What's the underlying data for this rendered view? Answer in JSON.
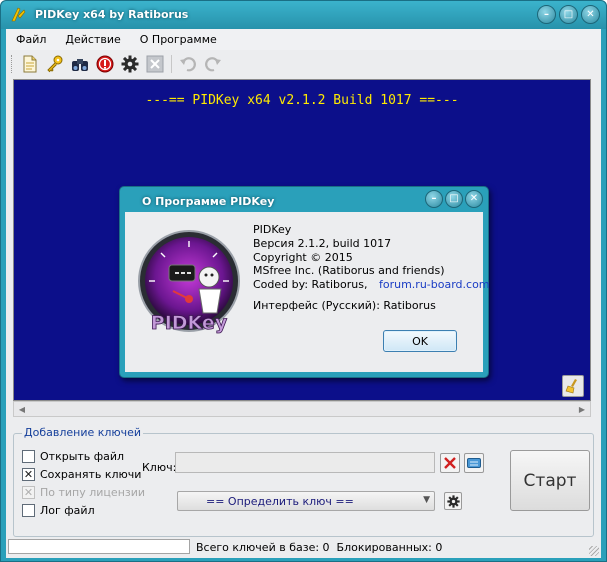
{
  "window": {
    "title": "PIDKey x64 by Ratiborus",
    "buttons": {
      "minimize": "–",
      "maximize": "□",
      "close": "✕"
    }
  },
  "menu": {
    "items": [
      "Файл",
      "Действие",
      "О Программе"
    ]
  },
  "toolbar": {
    "icons": [
      "open-file-icon",
      "key-icon",
      "binoculars-icon",
      "stop-icon",
      "gear-icon",
      "cancel-icon",
      "undo-icon",
      "redo-icon"
    ]
  },
  "console": {
    "header": "---== PIDKey x64 v2.1.2 Build 1017 ==---"
  },
  "bottom": {
    "group_title": "Добавление ключей",
    "checkboxes": [
      {
        "label": "Открыть файл",
        "checked": false,
        "mark": ""
      },
      {
        "label": "Сохранять ключи",
        "checked": true,
        "mark": "✕"
      },
      {
        "label": "По типу лицензии",
        "checked": true,
        "mark": "✕",
        "disabled": true
      },
      {
        "label": "Лог файл",
        "checked": false,
        "mark": ""
      }
    ],
    "key_label": "Ключ:",
    "key_value": "",
    "combo_value": "== Определить ключ ==",
    "start_label": "Старт"
  },
  "status": {
    "progress_fraction": 0,
    "text": "Всего ключей в базе: 0  Блокированных: 0"
  },
  "about": {
    "title": "О Программе PIDKey",
    "logo_text": "PIDKey",
    "lines": {
      "name": "PIDKey",
      "version": "Версия 2.1.2, build 1017",
      "copyright": "Copyright © 2015",
      "company": "MSfree Inc. (Ratiborus and friends)",
      "coded_prefix": "Coded by: Ratiborus,",
      "coded_link": "forum.ru-board.com",
      "interface": "Интерфейс (Русский): Ratiborus"
    },
    "ok_label": "OK"
  },
  "colors": {
    "console_bg": "#0c0f8a",
    "console_text": "#ffea00",
    "frame": "#2aa0ba",
    "link": "#1a3cc4"
  }
}
